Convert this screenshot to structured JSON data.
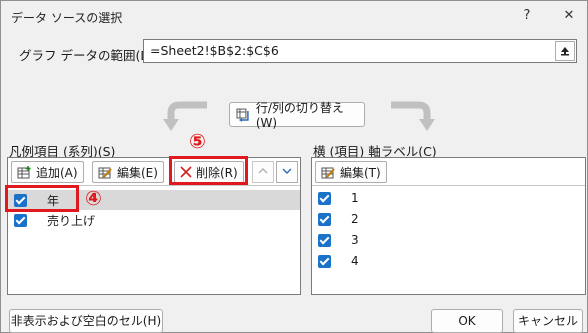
{
  "window": {
    "title": "データ ソースの選択",
    "help": "?",
    "close": "✕"
  },
  "range": {
    "label": "グラフ データの範囲(D):",
    "value": "=Sheet2!$B$2:$C$6"
  },
  "switch_button": "行/列の切り替え(W)",
  "legend": {
    "label": "凡例項目 (系列)(S)",
    "add": "追加(A)",
    "edit": "編集(E)",
    "delete": "削除(R)",
    "items": [
      {
        "label": "年",
        "checked": true,
        "selected": true
      },
      {
        "label": "売り上げ",
        "checked": true,
        "selected": false
      }
    ]
  },
  "axis": {
    "label": "横 (項目) 軸ラベル(C)",
    "edit": "編集(T)",
    "items": [
      {
        "label": "1",
        "checked": true
      },
      {
        "label": "2",
        "checked": true
      },
      {
        "label": "3",
        "checked": true
      },
      {
        "label": "4",
        "checked": true
      }
    ]
  },
  "annotations": {
    "step4": "④",
    "step5": "⑤"
  },
  "buttons": {
    "hidden_cells": "非表示および空白のセル(H)",
    "ok": "OK",
    "cancel": "キャンセル"
  },
  "colors": {
    "accent": "#1a73c8",
    "callout": "#e0191e"
  }
}
